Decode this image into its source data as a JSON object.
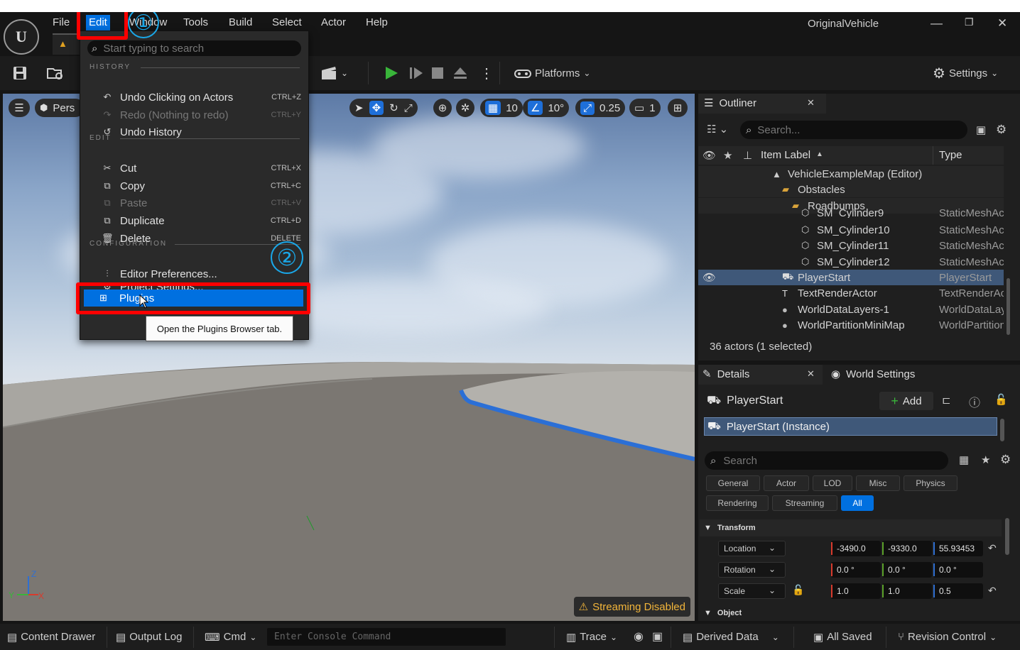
{
  "window": {
    "project_name": "OriginalVehicle",
    "minimize": "—",
    "restore": "❐",
    "close": "✕"
  },
  "menubar": {
    "items": [
      "File",
      "Edit",
      "Window",
      "Tools",
      "Build",
      "Select",
      "Actor",
      "Help"
    ]
  },
  "toolbar": {
    "platforms_label": "Platforms",
    "settings_label": "Settings"
  },
  "viewport": {
    "perspective_label": "Pers",
    "grid_snap": "10",
    "rotation_snap": "10°",
    "scale_snap": "0.25",
    "camera_speed": "1",
    "streaming_label": "Streaming Disabled",
    "axis_labels": {
      "z": "Z",
      "y": "Y",
      "x": "X"
    }
  },
  "edit_menu": {
    "search_placeholder": "Start typing to search",
    "sections": {
      "history": "HISTORY",
      "edit": "EDIT",
      "configuration": "CONFIGURATION"
    },
    "history_items": [
      {
        "label": "Undo Clicking on Actors",
        "shortcut": "CTRL+Z",
        "icon": "undo-icon"
      },
      {
        "label": "Redo (Nothing to redo)",
        "shortcut": "CTRL+Y",
        "icon": "redo-icon"
      },
      {
        "label": "Undo History",
        "shortcut": "",
        "icon": "history-icon"
      }
    ],
    "edit_items": [
      {
        "label": "Cut",
        "shortcut": "CTRL+X",
        "icon": "cut-icon"
      },
      {
        "label": "Copy",
        "shortcut": "CTRL+C",
        "icon": "copy-icon"
      },
      {
        "label": "Paste",
        "shortcut": "CTRL+V",
        "icon": "paste-icon"
      },
      {
        "label": "Duplicate",
        "shortcut": "CTRL+D",
        "icon": "duplicate-icon"
      },
      {
        "label": "Delete",
        "shortcut": "DELETE",
        "icon": "trash-icon"
      }
    ],
    "config_items": [
      {
        "label": "Editor Preferences...",
        "icon": "sliders-icon"
      },
      {
        "label": "Project Settings...",
        "icon": "gear-icon"
      },
      {
        "label": "Plugins",
        "icon": "plugin-icon"
      }
    ],
    "tooltip": "Open the Plugins Browser tab.",
    "annotations": [
      "①",
      "②"
    ]
  },
  "outliner": {
    "tab_label": "Outliner",
    "search_placeholder": "Search...",
    "columns": {
      "label": "Item Label",
      "type": "Type"
    },
    "rows": [
      {
        "label": "VehicleExampleMap (Editor)",
        "type": "",
        "indent": 1,
        "icon": "map-icon"
      },
      {
        "label": "Obstacles",
        "type": "",
        "indent": 2,
        "icon": "folder-icon"
      },
      {
        "label": "Roadbumps",
        "type": "",
        "indent": 3,
        "icon": "folder-icon"
      },
      {
        "label": "SM_Cylinder9",
        "type": "StaticMeshActor",
        "indent": 4,
        "icon": "mesh-icon"
      },
      {
        "label": "SM_Cylinder10",
        "type": "StaticMeshActor",
        "indent": 4,
        "icon": "mesh-icon"
      },
      {
        "label": "SM_Cylinder11",
        "type": "StaticMeshActor",
        "indent": 4,
        "icon": "mesh-icon"
      },
      {
        "label": "SM_Cylinder12",
        "type": "StaticMeshActor",
        "indent": 4,
        "icon": "mesh-icon"
      },
      {
        "label": "PlayerStart",
        "type": "PlayerStart",
        "indent": 2,
        "icon": "player-start-icon"
      },
      {
        "label": "TextRenderActor",
        "type": "TextRenderActor",
        "indent": 2,
        "icon": "text-render-icon"
      },
      {
        "label": "WorldDataLayers-1",
        "type": "WorldDataLayers",
        "indent": 2,
        "icon": "globe-icon"
      },
      {
        "label": "WorldPartitionMiniMap",
        "type": "WorldPartitionMiniMap",
        "indent": 2,
        "icon": "globe-icon"
      }
    ],
    "status": "36 actors (1 selected)"
  },
  "details": {
    "tab_label": "Details",
    "world_settings_label": "World Settings",
    "actor_name": "PlayerStart",
    "add_label": "Add",
    "component": "PlayerStart (Instance)",
    "search_placeholder": "Search",
    "filters": [
      "General",
      "Actor",
      "LOD",
      "Misc",
      "Physics",
      "Rendering",
      "Streaming",
      "All"
    ],
    "active_filter": "All",
    "transform_header": "Transform",
    "object_header": "Object",
    "location": {
      "label": "Location",
      "x": "-3490.0",
      "y": "-9330.0",
      "z": "55.93453"
    },
    "rotation": {
      "label": "Rotation",
      "x": "0.0 °",
      "y": "0.0 °",
      "z": "0.0 °"
    },
    "scale": {
      "label": "Scale",
      "x": "1.0",
      "y": "1.0",
      "z": "0.5"
    }
  },
  "statusbar": {
    "content_drawer": "Content Drawer",
    "output_log": "Output Log",
    "cmd": "Cmd",
    "console_placeholder": "Enter Console Command",
    "trace": "Trace",
    "derived_data": "Derived Data",
    "all_saved": "All Saved",
    "revision_control": "Revision Control"
  },
  "colors": {
    "accent": "#0070e0",
    "annotation_red": "#ff0000",
    "annotation_blue": "#1aa7e8",
    "selection": "#3f5879",
    "warning": "#f2b53a"
  }
}
